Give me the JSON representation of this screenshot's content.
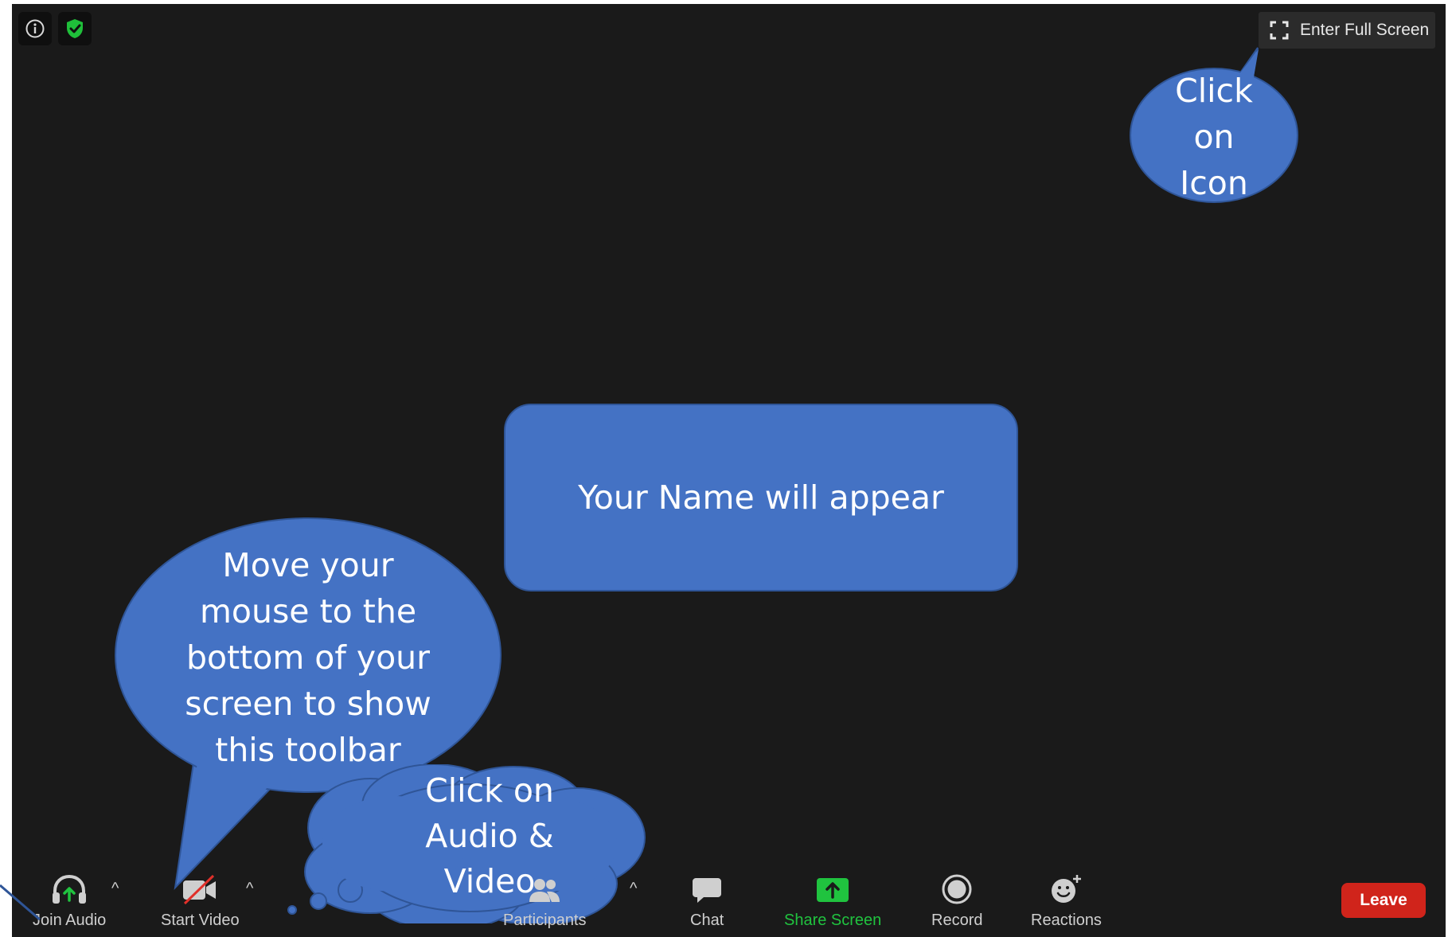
{
  "fullscreen": {
    "label": "Enter Full Screen"
  },
  "callouts": {
    "fullscreen_lines": [
      "Click",
      "on",
      "Icon"
    ],
    "name_box": "Your Name will appear",
    "toolbar_lines": [
      "Move your",
      "mouse to the",
      "bottom of your",
      "screen to show",
      "this toolbar"
    ],
    "audio_video_lines": [
      "Click on",
      "Audio &",
      "Video"
    ]
  },
  "toolbar": {
    "join_audio": "Join Audio",
    "start_video": "Start Video",
    "participants": "Participants",
    "chat": "Chat",
    "share_screen": "Share Screen",
    "record": "Record",
    "reactions": "Reactions",
    "leave": "Leave",
    "caret": "^"
  },
  "colors": {
    "meeting_bg": "#1a1a1a",
    "callout_fill": "#4472c4",
    "callout_border": "#2f5597",
    "share_green": "#20c33f",
    "leave_red": "#d0241b",
    "secure_green": "#1fbf3a"
  },
  "icons": {
    "info": "info-icon",
    "secure": "shield-check-icon",
    "fullscreen": "fullscreen-icon",
    "join_audio": "headphones-icon",
    "start_video": "video-off-icon",
    "participants": "participants-icon",
    "chat": "chat-icon",
    "share_screen": "share-screen-icon",
    "record": "record-icon",
    "reactions": "reactions-icon"
  }
}
